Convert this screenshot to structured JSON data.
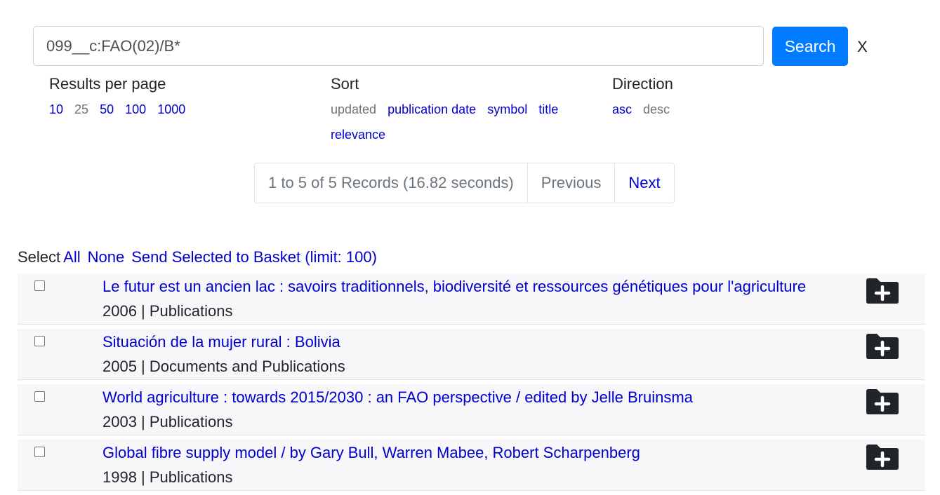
{
  "search": {
    "value": "099__c:FAO(02)/B*",
    "button_label": "Search",
    "clear_label": "X"
  },
  "options": {
    "results_per_page": {
      "label": "Results per page",
      "items": [
        "10",
        "25",
        "50",
        "100",
        "1000"
      ]
    },
    "sort": {
      "label": "Sort",
      "items": [
        "updated",
        "publication date",
        "symbol",
        "title"
      ],
      "items_second_line": [
        "relevance"
      ]
    },
    "direction": {
      "label": "Direction",
      "items": [
        "asc",
        "desc"
      ]
    }
  },
  "pager": {
    "summary": "1 to 5 of 5 Records (16.82 seconds)",
    "previous": "Previous",
    "next": "Next"
  },
  "selection": {
    "label": "Select",
    "all": "All",
    "none": "None",
    "send": "Send Selected to Basket (limit: 100)"
  },
  "results": [
    {
      "title": "Le futur est un ancien lac : savoirs traditionnels, biodiversité et ressources génétiques pour l'agriculture",
      "meta": "2006 | Publications"
    },
    {
      "title": "Situación de la mujer rural : Bolivia",
      "meta": "2005 | Documents and Publications"
    },
    {
      "title": "World agriculture : towards 2015/2030 : an FAO perspective / edited by Jelle Bruinsma",
      "meta": "2003 | Publications"
    },
    {
      "title": "Global fibre supply model / by Gary Bull, Warren Mabee, Robert Scharpenberg",
      "meta": "1998 | Publications"
    }
  ]
}
